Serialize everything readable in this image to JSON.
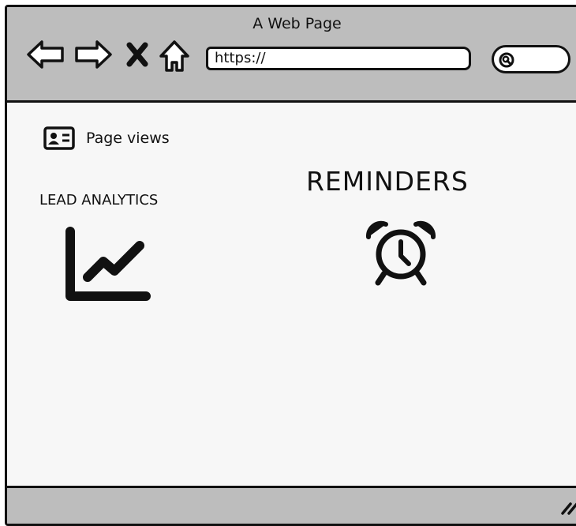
{
  "window": {
    "title": "A Web Page"
  },
  "toolbar": {
    "back_icon": "back-arrow-icon",
    "forward_icon": "forward-arrow-icon",
    "stop_icon": "close-x-icon",
    "home_icon": "home-icon",
    "url_value": "https://",
    "search_icon": "search-icon"
  },
  "content": {
    "page_views_icon": "id-card-icon",
    "page_views_label": "Page views",
    "lead_analytics_label": "LEAD ANALYTICS",
    "lead_analytics_icon": "line-chart-icon",
    "reminders_label": "REMINDERS",
    "reminders_icon": "alarm-clock-icon"
  },
  "statusbar": {
    "grip_icon": "resize-grip-icon"
  },
  "colors": {
    "chrome": "#bdbdbd",
    "content_bg": "#f7f7f7",
    "ink": "#111111"
  }
}
